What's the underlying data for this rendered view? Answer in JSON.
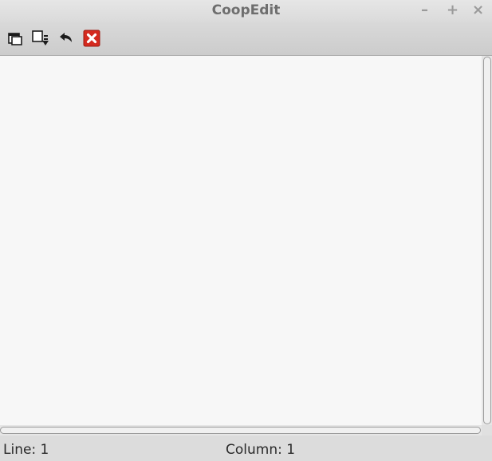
{
  "window": {
    "title": "CoopEdit",
    "minimize_glyph": "–",
    "maximize_glyph": "+",
    "close_glyph": "×"
  },
  "toolbar": {
    "buttons": [
      {
        "icon": "copy-icon"
      },
      {
        "icon": "save-icon"
      },
      {
        "icon": "undo-icon"
      },
      {
        "icon": "close-icon",
        "color": "#d42a1f"
      }
    ]
  },
  "editor": {
    "content": ""
  },
  "statusbar": {
    "line": "Line: 1",
    "column": "Column: 1"
  }
}
